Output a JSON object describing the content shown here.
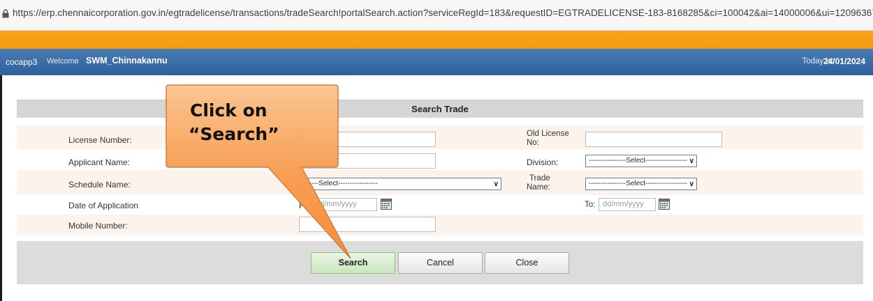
{
  "browser": {
    "url": "https://erp.chennaicorporation.gov.in/egtradelicense/transactions/tradeSearch!portalSearch.action?serviceRegId=183&requestID=EGTRADELICENSE-183-8168285&ci=100042&ai=14000006&ui=1209636797&sst..."
  },
  "header": {
    "user": "cocapp3",
    "welcome": "Welcome",
    "username": "SWM_Chinnakannu",
    "today_label": "Today is:",
    "today_date": "24/01/2024",
    "accent_orange": "#f39b12",
    "accent_blue": "#3a6aa5"
  },
  "form": {
    "title": "Search Trade",
    "license_number_label": "License Number:",
    "applicant_name_label": "Applicant Name:",
    "schedule_name_label": "Schedule Name:",
    "date_of_application_label": "Date of Application",
    "mobile_number_label": "Mobile Number:",
    "old_license_label_1": "Old License",
    "old_license_label_2": "No:",
    "division_label": "Division:",
    "trade_name_label_1": "Trade",
    "trade_name_label_2": "Name:",
    "schedule_select": "-------Select-----------------",
    "division_select": "----------------Select------------------",
    "trade_select": "----------------Select------------------",
    "from_prefix": "F",
    "from_placeholder": "dd/mm/yyyy",
    "to_label": "To:",
    "to_placeholder": "dd/mm/yyyy"
  },
  "buttons": {
    "search": "Search",
    "cancel": "Cancel",
    "close": "Close"
  },
  "callout": {
    "line1": "Click on",
    "line2": "“Search”",
    "color": "#f7963a"
  }
}
